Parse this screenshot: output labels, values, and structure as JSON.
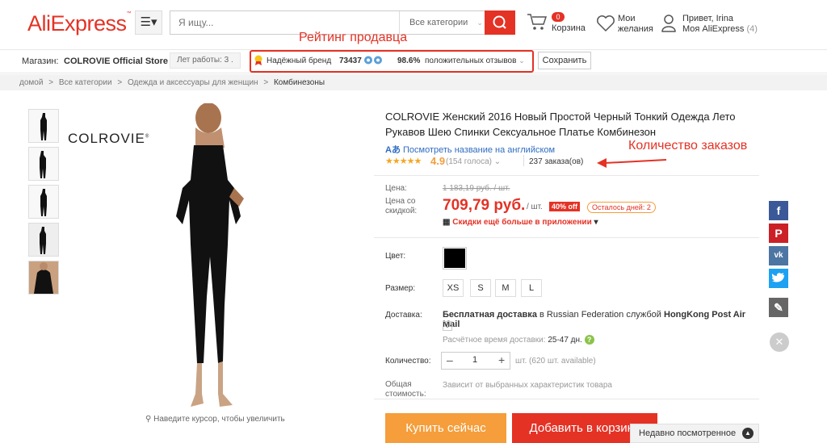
{
  "header": {
    "logo": "AliExpress",
    "search_placeholder": "Я ищу...",
    "categories_label": "Все категории",
    "cart_count": "0",
    "cart_label": "Корзина",
    "wishlist_line1": "Мои",
    "wishlist_line2": "желания",
    "account_line1": "Привет, Irina",
    "account_line2": "Моя AliExpress",
    "account_count": "(4)"
  },
  "annotations": {
    "seller_rating": "Рейтинг продавца",
    "orders_count": "Количество заказов"
  },
  "store": {
    "label": "Магазин:",
    "name": "COLROVIE Official Store",
    "years": "Лет работы: 3 .",
    "trusted": "Надёжный бренд",
    "score": "73437",
    "positive_pct": "98.6%",
    "positive_label": "положительных отзывов",
    "save_label": "Сохранить"
  },
  "breadcrumb": [
    "домой",
    ">",
    "Все категории",
    ">",
    "Одежда и аксессуары для женщин",
    ">",
    "Комбинезоны"
  ],
  "gallery": {
    "brand": "COLROVIE",
    "zoom_hint": "Наведите курсор, чтобы увеличить"
  },
  "product": {
    "title": "COLROVIE Женский 2016 Новый Простой Черный Тонкий Одежда Лето Рукавов Шею Спинки Сексуальное Платье Комбинезон",
    "translate_link": "Посмотреть название на английском",
    "rating": "4.9",
    "votes": "(154 голоса)",
    "orders": "237 заказа(ов)",
    "price_label": "Цена:",
    "old_price": "1 183,19 руб. / шт.",
    "discount_label_1": "Цена со",
    "discount_label_2": "скидкой:",
    "price": "709,79 руб.",
    "per_unit": "/ шт.",
    "off_badge": "40% off",
    "days_left": "Осталось дней: 2",
    "app_discount": "Скидки ещё больше в приложении",
    "color_label": "Цвет:",
    "size_label": "Размер:",
    "sizes": [
      "XS",
      "S",
      "M",
      "L"
    ],
    "delivery_label": "Доставка:",
    "delivery_text_bold1": "Бесплатная доставка",
    "delivery_text_mid1": "в",
    "delivery_text_country": "Russian Federation",
    "delivery_text_mid2": "службой",
    "delivery_text_bold2": "HongKong Post Air Mail",
    "delivery_time_label": "Расчётное время доставки:",
    "delivery_time": "25-47 дн.",
    "qty_label": "Количество:",
    "qty_value": "1",
    "qty_available": "шт. (620 шт. available)",
    "total_label_1": "Общая",
    "total_label_2": "стоимость:",
    "total_text": "Зависит от выбранных характеристик товара",
    "buy_now": "Купить сейчас",
    "add_to_cart": "Добавить в корзину"
  },
  "recent": "Недавно посмотренное",
  "colors": {
    "brand": "#e43225",
    "buy": "#f59e3b"
  }
}
